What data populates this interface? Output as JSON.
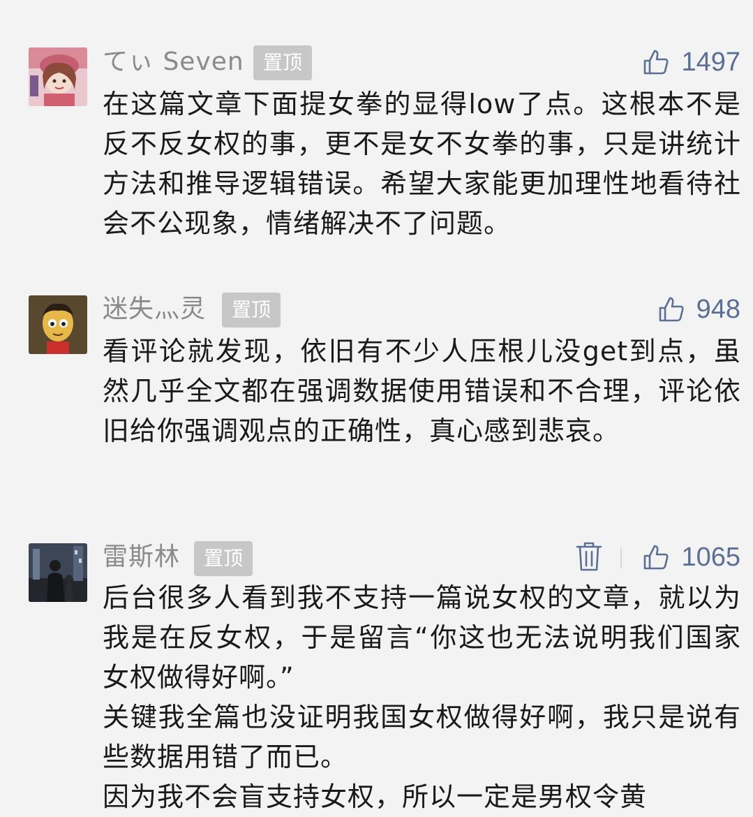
{
  "comments": [
    {
      "user": "てぃ Seven",
      "pinned_label": "置顶",
      "likes": "1497",
      "deletable": false,
      "lines": [
        "在这篇文章下面提女拳的显得low了点。这根本不是反不反女权的事，更不是女不女拳的事，只是讲统计方法和推导逻辑错误。希望大家能更加理性地看待社会不公现象，情绪解决不了问题。"
      ],
      "avatar_icon": "cartoon-girl-avatar"
    },
    {
      "user": "迷失灬灵",
      "pinned_label": "置顶",
      "likes": "948",
      "deletable": false,
      "lines": [
        "看评论就发现，依旧有不少人压根儿没get到点，虽然几乎全文都在强调数据使用错误和不合理，评论依旧给你强调观点的正确性，真心感到悲哀。"
      ],
      "avatar_icon": "cartoon-face-avatar"
    },
    {
      "user": "雷斯林",
      "pinned_label": "置顶",
      "likes": "1065",
      "deletable": true,
      "lines": [
        "后台很多人看到我不支持一篇说女权的文章，就以为我是在反女权，于是留言“你这也无法说明我们国家女权做得好啊。”",
        "关键我全篇也没证明我国女权做得好啊，我只是说有些数据用错了而已。",
        "因为我不会盲支持女权，所以一定是男权令黄"
      ],
      "avatar_icon": "dark-photo-avatar"
    }
  ],
  "colors": {
    "background": "#f3f3f3",
    "username": "#8a8a8a",
    "badge_bg": "#c7c7c7",
    "like_blue": "#5a6f93",
    "text": "#1a1a1a"
  },
  "icons": {
    "like": "thumbs-up-icon",
    "delete": "trash-icon"
  }
}
